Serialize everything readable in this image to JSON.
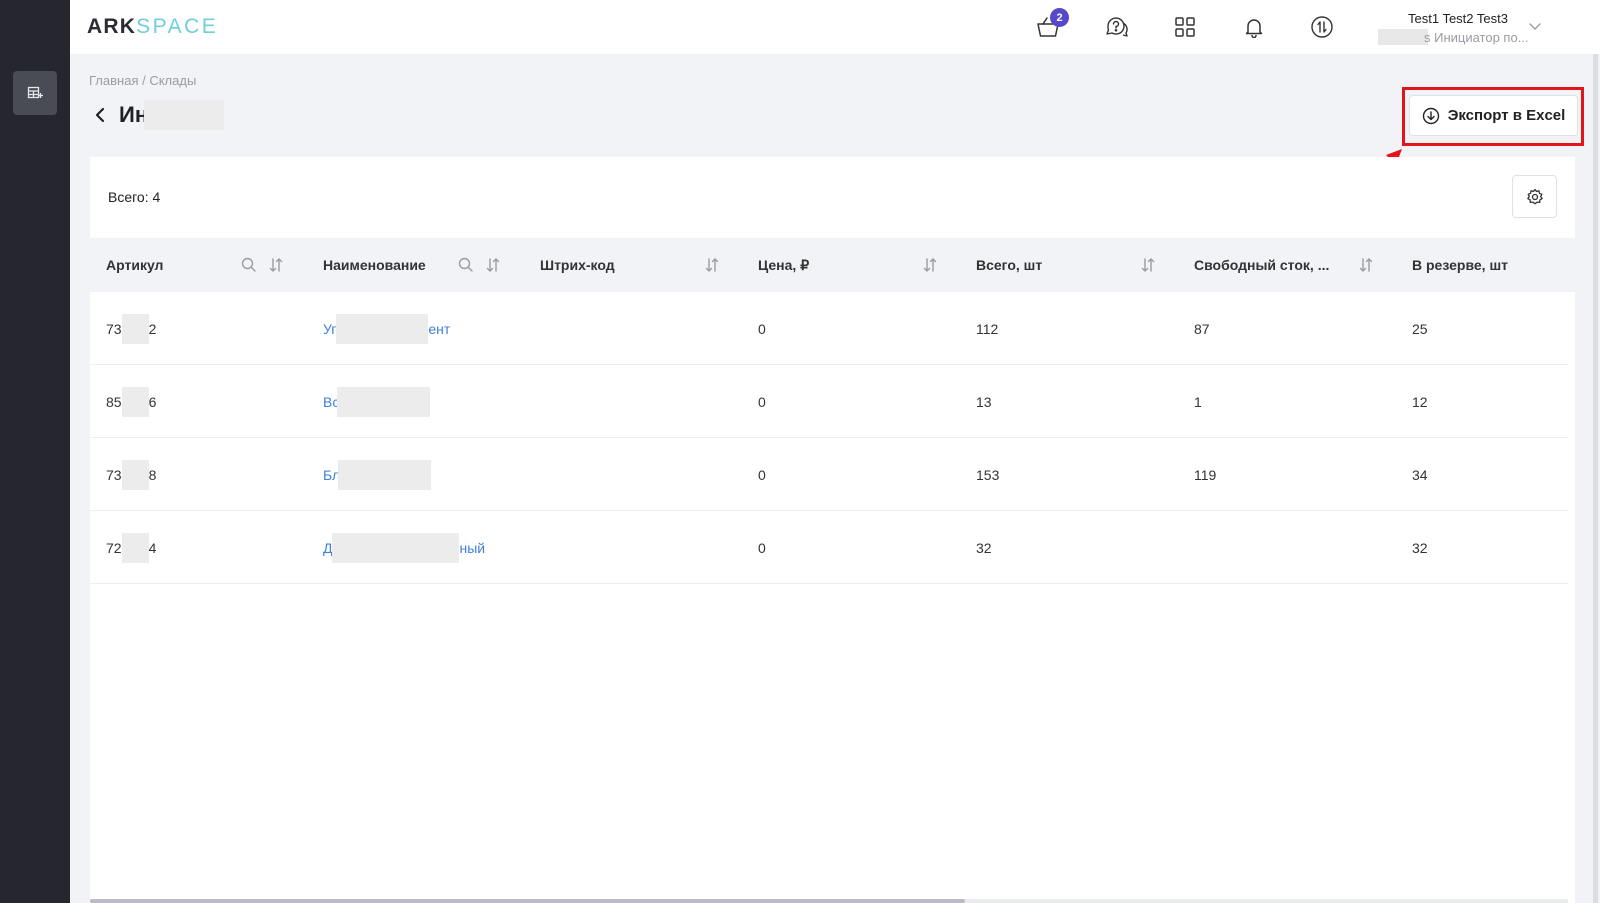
{
  "app": {
    "logo_part1": "ARK",
    "logo_part2": "SPACE"
  },
  "topbar": {
    "cart_badge": "2",
    "user_name": "Test1 Test2 Test3",
    "user_role": "s Инициатор по..."
  },
  "breadcrumb": "Главная / Склады",
  "page": {
    "title": "Ин"
  },
  "toolbar": {
    "export_label": "Экспорт в Excel",
    "total_label": "Всего: 4"
  },
  "table": {
    "columns": [
      "Артикул",
      "Наименование",
      "Штрих-код",
      "Цена, ₽",
      "Всего, шт",
      "Свободный сток, ...",
      "В резерве, шт"
    ],
    "rows": [
      {
        "sku_a": "73",
        "sku_b": "2",
        "name_a": "Уг",
        "name_b": "ент",
        "barcode": "",
        "price": "0",
        "total": "112",
        "free": "87",
        "reserved": "25"
      },
      {
        "sku_a": "85",
        "sku_b": "6",
        "name_a": "Вс",
        "name_b": "",
        "barcode": "",
        "price": "0",
        "total": "13",
        "free": "1",
        "reserved": "12"
      },
      {
        "sku_a": "73",
        "sku_b": "8",
        "name_a": "Бл",
        "name_b": "",
        "barcode": "",
        "price": "0",
        "total": "153",
        "free": "119",
        "reserved": "34"
      },
      {
        "sku_a": "72",
        "sku_b": "4",
        "name_a": "Д",
        "name_b": "ный",
        "barcode": "",
        "price": "0",
        "total": "32",
        "free": "",
        "reserved": "32"
      }
    ]
  },
  "colors": {
    "sidebar": "#26272e",
    "accent": "#5549c9",
    "link": "#3f7fd8",
    "highlight": "#e3141b"
  },
  "icons": [
    "table-plus-icon",
    "basket-icon",
    "chat-help-icon",
    "grid-icon",
    "bell-icon",
    "switch-icon",
    "chevron-down-icon",
    "back-arrow-icon",
    "download-icon",
    "gear-icon",
    "search-icon",
    "sort-icon"
  ]
}
